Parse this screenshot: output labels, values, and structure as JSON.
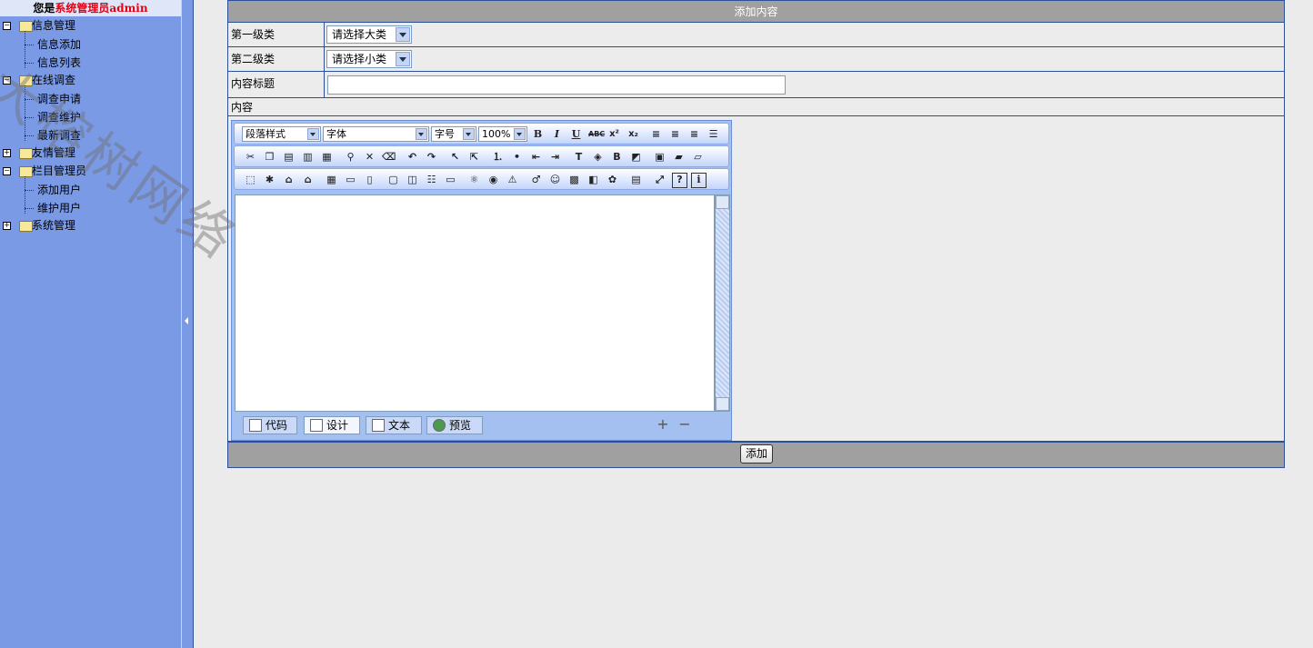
{
  "sidebar": {
    "welcome_prefix": "您是",
    "welcome_role": "系统管理员admin",
    "tree": [
      {
        "label": "信息管理"
      },
      {
        "label": "信息添加"
      },
      {
        "label": "信息列表"
      },
      {
        "label": "在线调查"
      },
      {
        "label": "调查申请"
      },
      {
        "label": "调查维护"
      },
      {
        "label": "最新调查"
      },
      {
        "label": "友情管理"
      },
      {
        "label": "栏目管理员"
      },
      {
        "label": "添加用户"
      },
      {
        "label": "维护用户"
      },
      {
        "label": "系统管理"
      }
    ],
    "collapse_icon": "left-arrow-icon"
  },
  "watermark": "大榕树网络",
  "form": {
    "header": "添加内容",
    "category1_label": "第一级类",
    "category1_value": "请选择大类",
    "category2_label": "第二级类",
    "category2_value": "请选择小类",
    "title_label": "内容标题",
    "title_value": "",
    "content_label": "内容",
    "submit_label": "添加"
  },
  "editor": {
    "paragraph_style": "段落样式",
    "font": "字体",
    "font_size": "字号",
    "zoom": "100%",
    "tabs": [
      {
        "label": "代码",
        "icon": "code-icon"
      },
      {
        "label": "设计",
        "icon": "design-icon"
      },
      {
        "label": "文本",
        "icon": "text-icon"
      },
      {
        "label": "预览",
        "icon": "globe-icon"
      }
    ],
    "active_tab": "设计",
    "bold": "B",
    "italic": "I",
    "underline": "U",
    "strike": "ABC",
    "superscript": "x²",
    "subscript": "x₂",
    "help": "?",
    "info": "i"
  },
  "colors": {
    "sidebar": "#7b9ae6",
    "header": "#a0a0a0",
    "border": "#2d4f9a",
    "highlight": "#e60012"
  }
}
